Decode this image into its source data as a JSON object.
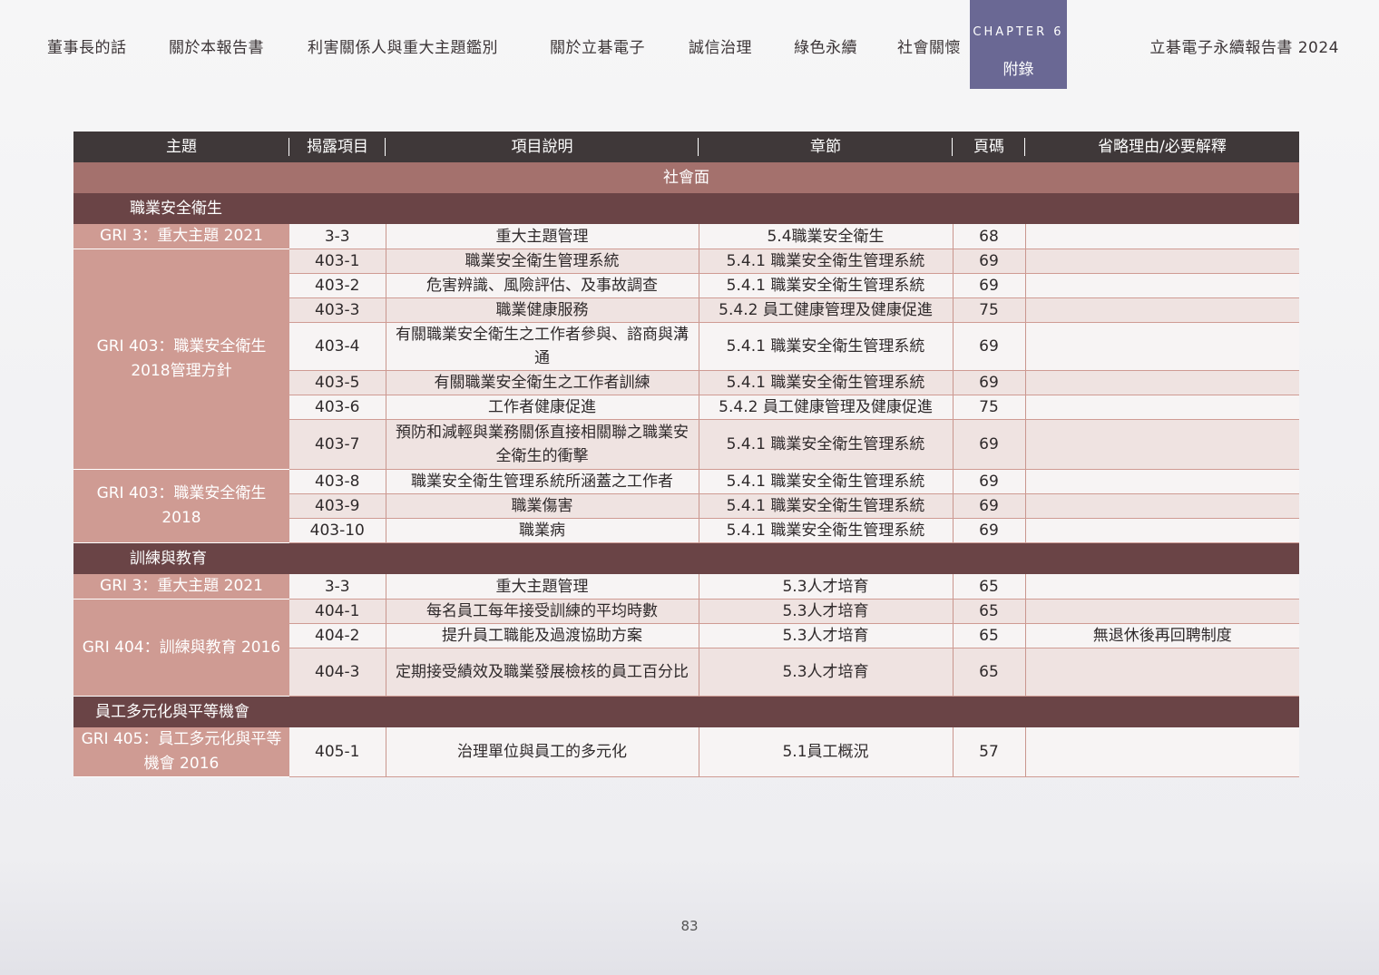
{
  "nav": {
    "items": [
      "董事長的話",
      "關於本報告書",
      "利害關係人與重大主題鑑別",
      "關於立碁電子",
      "誠信治理",
      "綠色永續",
      "社會關懷"
    ],
    "chapter_label": "CHAPTER 6",
    "chapter_title": "附錄",
    "report_title": "立碁電子永續報告書 2024"
  },
  "table": {
    "headers": [
      "主題",
      "揭露項目",
      "項目說明",
      "章節",
      "頁碼",
      "省略理由/必要解釋"
    ],
    "dimension": "社會面",
    "sections": [
      {
        "title": "職業安全衛生",
        "groups": [
          {
            "standard": "GRI 3：重大主題 2021",
            "rows": [
              {
                "code": "3-3",
                "desc": "重大主題管理",
                "chapter": "5.4職業安全衛生",
                "page": "68",
                "note": ""
              }
            ]
          },
          {
            "standard": "GRI 403：職業安全衛生 2018管理方針",
            "rows": [
              {
                "code": "403-1",
                "desc": "職業安全衛生管理系統",
                "chapter": "5.4.1 職業安全衛生管理系統",
                "page": "69",
                "note": ""
              },
              {
                "code": "403-2",
                "desc": "危害辨識、風險評估、及事故調查",
                "chapter": "5.4.1 職業安全衛生管理系統",
                "page": "69",
                "note": ""
              },
              {
                "code": "403-3",
                "desc": "職業健康服務",
                "chapter": "5.4.2 員工健康管理及健康促進",
                "page": "75",
                "note": ""
              },
              {
                "code": "403-4",
                "desc": "有關職業安全衛生之工作者參與、諮商與溝通",
                "chapter": "5.4.1 職業安全衛生管理系統",
                "page": "69",
                "note": ""
              },
              {
                "code": "403-5",
                "desc": "有關職業安全衛生之工作者訓練",
                "chapter": "5.4.1 職業安全衛生管理系統",
                "page": "69",
                "note": ""
              },
              {
                "code": "403-6",
                "desc": "工作者健康促進",
                "chapter": "5.4.2 員工健康管理及健康促進",
                "page": "75",
                "note": ""
              },
              {
                "code": "403-7",
                "desc": "預防和減輕與業務關係直接相關聯之職業安全衛生的衝擊",
                "chapter": "5.4.1 職業安全衛生管理系統",
                "page": "69",
                "note": ""
              }
            ]
          },
          {
            "standard": "GRI 403：職業安全衛生 2018",
            "rows": [
              {
                "code": "403-8",
                "desc": "職業安全衛生管理系統所涵蓋之工作者",
                "chapter": "5.4.1 職業安全衛生管理系統",
                "page": "69",
                "note": ""
              },
              {
                "code": "403-9",
                "desc": "職業傷害",
                "chapter": "5.4.1 職業安全衛生管理系統",
                "page": "69",
                "note": ""
              },
              {
                "code": "403-10",
                "desc": "職業病",
                "chapter": "5.4.1 職業安全衛生管理系統",
                "page": "69",
                "note": ""
              }
            ]
          }
        ]
      },
      {
        "title": "訓練與教育",
        "groups": [
          {
            "standard": "GRI 3：重大主題 2021",
            "rows": [
              {
                "code": "3-3",
                "desc": "重大主題管理",
                "chapter": "5.3人才培育",
                "page": "65",
                "note": ""
              }
            ]
          },
          {
            "standard": "GRI 404：訓練與教育 2016",
            "rows": [
              {
                "code": "404-1",
                "desc": "每名員工每年接受訓練的平均時數",
                "chapter": "5.3人才培育",
                "page": "65",
                "note": ""
              },
              {
                "code": "404-2",
                "desc": "提升員工職能及過渡協助方案",
                "chapter": "5.3人才培育",
                "page": "65",
                "note": "無退休後再回聘制度"
              },
              {
                "code": "404-3",
                "desc": "定期接受績效及職業發展檢核的員工百分比",
                "chapter": "5.3人才培育",
                "page": "65",
                "note": ""
              }
            ]
          }
        ]
      },
      {
        "title": "員工多元化與平等機會",
        "groups": [
          {
            "standard": "GRI 405：員工多元化與平等機會 2016",
            "rows": [
              {
                "code": "405-1",
                "desc": "治理單位與員工的多元化",
                "chapter": "5.1員工概況",
                "page": "57",
                "note": ""
              }
            ]
          }
        ]
      }
    ]
  },
  "page_number": "83"
}
